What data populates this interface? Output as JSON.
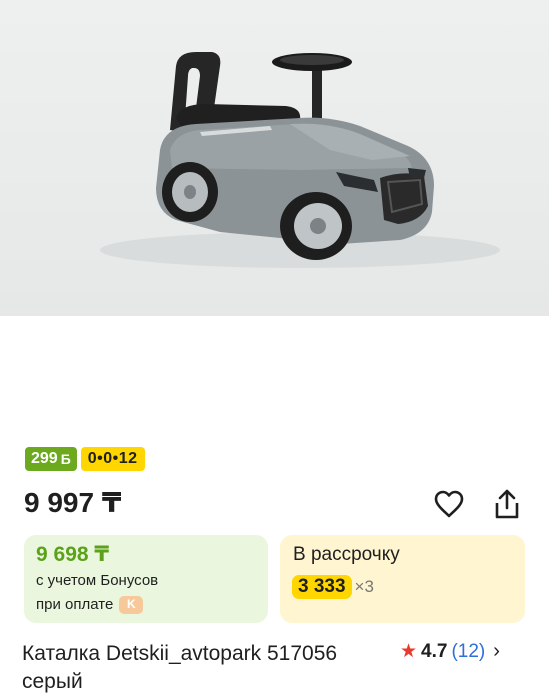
{
  "product": {
    "image_alt": "",
    "badges": {
      "bonus": "299",
      "bonus_icon": "Б",
      "installment": "0•0•12"
    },
    "price": "9 997 ₸",
    "actions": {
      "favorite_icon": "heart-icon",
      "share_icon": "share-icon"
    },
    "bonus_card": {
      "price": "9 698 ₸",
      "line1": "с учетом Бонусов",
      "line2": "при оплате",
      "payment_icon": "kaspi-icon"
    },
    "installment_card": {
      "title": "В рассрочку",
      "amount": "3 333",
      "multiplier": "×3"
    },
    "title": "Каталка Detskii_avtopark 517056 серый",
    "rating": {
      "value": "4.7",
      "count": "(12)"
    }
  },
  "colors": {
    "bonus_green": "#6ca91f",
    "installment_yellow": "#ffd600",
    "rating_star": "#e8392c",
    "link_blue": "#2f6fd8"
  }
}
